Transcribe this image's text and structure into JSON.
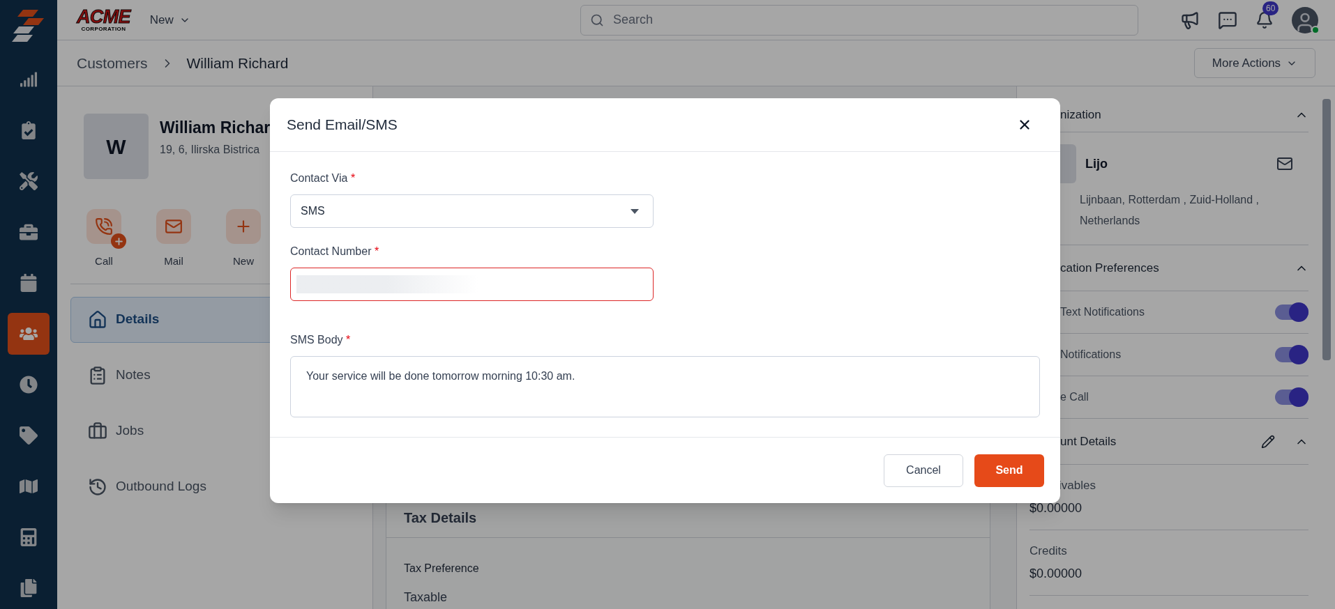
{
  "rail": {
    "items": [
      {
        "selected": false
      },
      {
        "selected": false
      },
      {
        "selected": false
      },
      {
        "selected": false
      },
      {
        "selected": false
      },
      {
        "selected": true
      },
      {
        "selected": false
      },
      {
        "selected": false
      },
      {
        "selected": false
      },
      {
        "selected": false
      },
      {
        "selected": false
      }
    ]
  },
  "topbar": {
    "logo": {
      "name": "ACME",
      "tagline": "CORPORATION"
    },
    "new_menu": "New",
    "search": {
      "placeholder": "Search"
    },
    "notifications_badge": "60",
    "user_online": true
  },
  "breadcrumb": {
    "items": [
      "Customers",
      "William Richard"
    ]
  },
  "more_actions": "More Actions",
  "customer": {
    "initial": "W",
    "name": "William Richar",
    "address": "19, 6, Ilirska Bistrica"
  },
  "quick_actions": [
    "Call",
    "Mail",
    "New"
  ],
  "nav": [
    {
      "label": "Details",
      "selected": true
    },
    {
      "label": "Notes",
      "selected": false
    },
    {
      "label": "Jobs",
      "selected": false
    },
    {
      "label": "Outbound Logs",
      "selected": false
    }
  ],
  "tax_details": {
    "title": "Tax Details",
    "fields": [
      {
        "label": "Tax Preference",
        "value": "Taxable"
      }
    ]
  },
  "right_panel": {
    "organization": {
      "title": "nization",
      "expanded": true,
      "contact_name": "Lijo",
      "address_lines": [
        "Lijnbaan, Rotterdam , Zuid-Holland ,",
        "Netherlands"
      ]
    },
    "communication_preferences": {
      "title": "cation Preferences",
      "expanded": true,
      "items": [
        {
          "label": "Text Notifications",
          "on": true
        },
        {
          "label": "Notifications",
          "on": true
        },
        {
          "label": "e Call",
          "on": true
        }
      ]
    },
    "account_details": {
      "title": "unt Details",
      "expanded": true,
      "fields": [
        {
          "label": "ivables",
          "value": "$0.00000"
        },
        {
          "label": "Credits",
          "value": "$0.00000"
        }
      ]
    }
  },
  "dialog": {
    "title": "Send Email/SMS",
    "fields": [
      {
        "kind": "select",
        "label": "Contact Via",
        "required_mark": "*",
        "value": "SMS",
        "invalid": false
      },
      {
        "kind": "input",
        "label": "Contact Number",
        "required_mark": "*",
        "redacted": true,
        "invalid": true
      },
      {
        "kind": "textarea",
        "label": "SMS Body",
        "required_mark": "*",
        "value": "Your service will be done tomorrow morning 10:30 am.",
        "invalid": false
      }
    ],
    "buttons": [
      {
        "label": "Cancel",
        "kind": "secondary"
      },
      {
        "label": "Send",
        "kind": "primary"
      }
    ]
  }
}
